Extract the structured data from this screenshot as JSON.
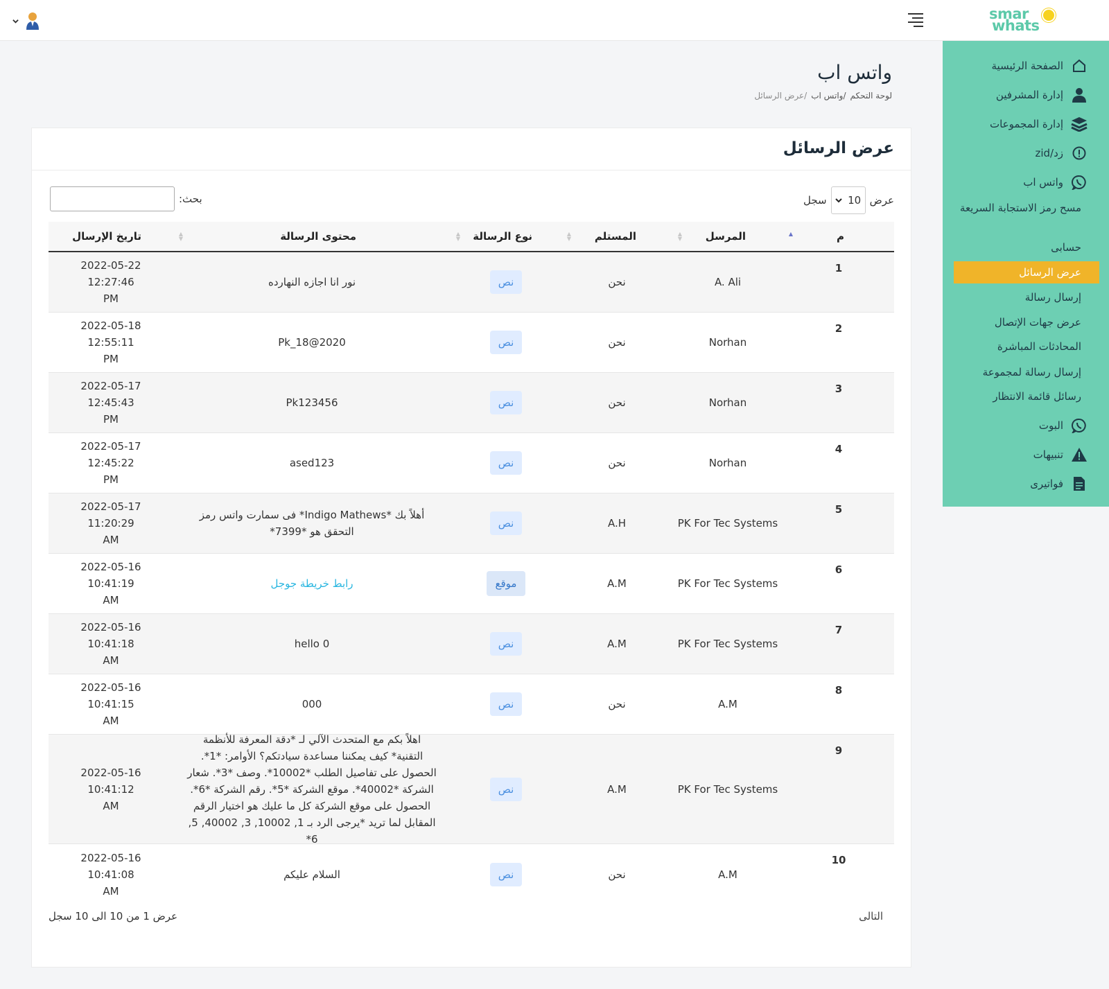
{
  "header": {
    "logo_line1": "smar",
    "logo_line2": "whats",
    "menu_icon": "hamburger-icon",
    "user_icon": "user-avatar-icon"
  },
  "sidebar": {
    "items": [
      {
        "label": "الصفحة الرئيسية",
        "icon": "home-icon"
      },
      {
        "label": "إدارة المشرفين",
        "icon": "user-icon"
      },
      {
        "label": "إدارة المجموعات",
        "icon": "layers-icon"
      },
      {
        "label": "زد/zid",
        "icon": "alert-circle-icon"
      },
      {
        "label": "واتس اب",
        "icon": "whatsapp-icon"
      },
      {
        "label": "مسح رمز الاستجابة السريعة"
      },
      {
        "label": "حسابى"
      },
      {
        "label": "عرض الرسائل",
        "active": true
      },
      {
        "label": "إرسال رسالة"
      },
      {
        "label": "عرض جهات الإتصال"
      },
      {
        "label": "المحادثات المباشرة"
      },
      {
        "label": "إرسال رسالة لمجموعة"
      },
      {
        "label": "رسائل قائمة الانتظار"
      },
      {
        "label": "البوت",
        "icon": "whatsapp-icon"
      },
      {
        "label": "تنبيهات",
        "icon": "warning-icon"
      },
      {
        "label": "فواتيرى",
        "icon": "invoice-icon"
      }
    ],
    "active_color": "#f0b429",
    "bg_color": "#6dcfb3"
  },
  "page": {
    "title": "واتس اب",
    "breadcrumb": [
      "لوحة التحكم",
      "/واتس اب",
      "/عرض الرسائل"
    ]
  },
  "card": {
    "title": "عرض الرسائل",
    "length_prefix": "عرض",
    "length_value": "10",
    "length_suffix": "سجل",
    "search_label": "بحث:",
    "search_value": ""
  },
  "table": {
    "columns": [
      "م",
      "المرسل",
      "المستلم",
      "نوع الرسالة",
      "محتوى الرسالة",
      "تاريخ الإرسال"
    ],
    "rows": [
      {
        "n": "1",
        "sender": "A. Ali",
        "receiver": "نحن",
        "type": "نص",
        "content": "نور انا اجازه النهارده",
        "date": "2022-05-22",
        "time": "12:27:46",
        "ampm": "PM"
      },
      {
        "n": "2",
        "sender": "Norhan",
        "receiver": "نحن",
        "type": "نص",
        "content": "Pk_18@2020",
        "date": "2022-05-18",
        "time": "12:55:11",
        "ampm": "PM"
      },
      {
        "n": "3",
        "sender": "Norhan",
        "receiver": "نحن",
        "type": "نص",
        "content": "Pk123456",
        "date": "2022-05-17",
        "time": "12:45:43",
        "ampm": "PM"
      },
      {
        "n": "4",
        "sender": "Norhan",
        "receiver": "نحن",
        "type": "نص",
        "content": "ased123",
        "date": "2022-05-17",
        "time": "12:45:22",
        "ampm": "PM"
      },
      {
        "n": "5",
        "sender": "PK For Tec Systems",
        "receiver": "A.H",
        "type": "نص",
        "content": "أهلاً بك *Indigo Mathews* فى سمارت واتس رمز التحقق هو *7399*",
        "date": "2022-05-17",
        "time": "11:20:29",
        "ampm": "AM"
      },
      {
        "n": "6",
        "sender": "PK For Tec Systems",
        "receiver": "A.M",
        "type": "موقع",
        "content": "رابط خريطة جوجل",
        "date": "2022-05-16",
        "time": "10:41:19",
        "ampm": "AM",
        "link": true
      },
      {
        "n": "7",
        "sender": "PK For Tec Systems",
        "receiver": "A.M",
        "type": "نص",
        "content": "hello 0",
        "date": "2022-05-16",
        "time": "10:41:18",
        "ampm": "AM"
      },
      {
        "n": "8",
        "sender": "A.M",
        "receiver": "نحن",
        "type": "نص",
        "content": "000",
        "date": "2022-05-16",
        "time": "10:41:15",
        "ampm": "AM"
      },
      {
        "n": "9",
        "sender": "PK For Tec Systems",
        "receiver": "A.M",
        "type": "نص",
        "content": "اهلاً بكم مع المتحدث الآلي لـ *دقة المعرفة للأنظمة التقنية* كيف يمكننا مساعدة سيادتكم؟ الأوامر: *1*. الحصول على تفاصيل الطلب *10002*. وصف *3*. شعار الشركة *40002*. موقع الشركة *5*. رقم الشركة *6*. الحصول على موقع الشركة كل ما عليك هو اختيار الرقم المقابل لما تريد *يرجى الرد بـ 1, 10002, 3, 40002, 5, 6*",
        "date": "2022-05-16",
        "time": "10:41:12",
        "ampm": "AM"
      },
      {
        "n": "10",
        "sender": "A.M",
        "receiver": "نحن",
        "type": "نص",
        "content": "السلام عليكم",
        "date": "2022-05-16",
        "time": "10:41:08",
        "ampm": "AM"
      }
    ]
  },
  "pagination": {
    "info": "عرض 1 من 10 الى 10 سجل",
    "next": "التالى"
  }
}
